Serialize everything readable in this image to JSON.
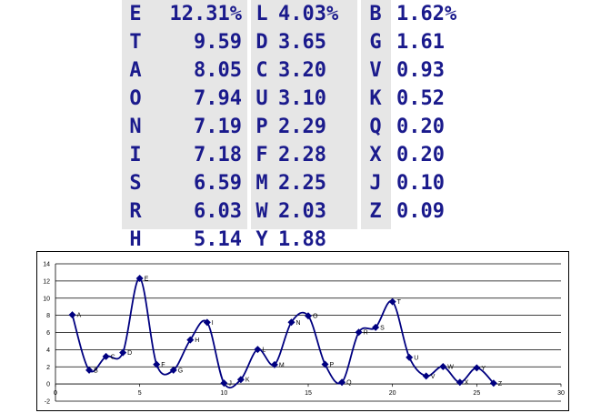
{
  "table": {
    "columns": [
      {
        "rows": [
          {
            "letter": "E",
            "value": "12.31%"
          },
          {
            "letter": "T",
            "value": "9.59"
          },
          {
            "letter": "A",
            "value": "8.05"
          },
          {
            "letter": "O",
            "value": "7.94"
          },
          {
            "letter": "N",
            "value": "7.19"
          },
          {
            "letter": "I",
            "value": "7.18"
          },
          {
            "letter": "S",
            "value": "6.59"
          },
          {
            "letter": "R",
            "value": "6.03"
          },
          {
            "letter": "H",
            "value": "5.14"
          }
        ]
      },
      {
        "rows": [
          {
            "letter": "L",
            "value": "4.03%"
          },
          {
            "letter": "D",
            "value": "3.65"
          },
          {
            "letter": "C",
            "value": "3.20"
          },
          {
            "letter": "U",
            "value": "3.10"
          },
          {
            "letter": "P",
            "value": "2.29"
          },
          {
            "letter": "F",
            "value": "2.28"
          },
          {
            "letter": "M",
            "value": "2.25"
          },
          {
            "letter": "W",
            "value": "2.03"
          },
          {
            "letter": "Y",
            "value": "1.88"
          }
        ]
      },
      {
        "rows": [
          {
            "letter": "B",
            "value": "1.62%"
          },
          {
            "letter": "G",
            "value": "1.61"
          },
          {
            "letter": "V",
            "value": "0.93"
          },
          {
            "letter": "K",
            "value": "0.52"
          },
          {
            "letter": "Q",
            "value": "0.20"
          },
          {
            "letter": "X",
            "value": "0.20"
          },
          {
            "letter": "J",
            "value": "0.10"
          },
          {
            "letter": "Z",
            "value": "0.09"
          }
        ]
      }
    ]
  },
  "chart_data": {
    "type": "line",
    "smoothed": true,
    "marker": "diamond",
    "color": "#000080",
    "grid": "horizontal",
    "legend": "none",
    "xlim": [
      0,
      30
    ],
    "ylim": [
      -2,
      14
    ],
    "xticks": [
      "0",
      "5",
      "10",
      "15",
      "20",
      "25",
      "30"
    ],
    "yticks": [
      "-2",
      "0",
      "2",
      "4",
      "6",
      "8",
      "10",
      "12",
      "14"
    ],
    "series": [
      {
        "points": [
          {
            "x": 1,
            "y": 8.05,
            "label": "A"
          },
          {
            "x": 2,
            "y": 1.62,
            "label": "B"
          },
          {
            "x": 3,
            "y": 3.2,
            "label": "C"
          },
          {
            "x": 4,
            "y": 3.65,
            "label": "D"
          },
          {
            "x": 5,
            "y": 12.31,
            "label": "E"
          },
          {
            "x": 6,
            "y": 2.28,
            "label": "F"
          },
          {
            "x": 7,
            "y": 1.61,
            "label": "G"
          },
          {
            "x": 8,
            "y": 5.14,
            "label": "H"
          },
          {
            "x": 9,
            "y": 7.18,
            "label": "I"
          },
          {
            "x": 10,
            "y": 0.1,
            "label": "J"
          },
          {
            "x": 11,
            "y": 0.52,
            "label": "K"
          },
          {
            "x": 12,
            "y": 4.03,
            "label": "L"
          },
          {
            "x": 13,
            "y": 2.25,
            "label": "M"
          },
          {
            "x": 14,
            "y": 7.19,
            "label": "N"
          },
          {
            "x": 15,
            "y": 7.94,
            "label": "O"
          },
          {
            "x": 16,
            "y": 2.29,
            "label": "P"
          },
          {
            "x": 17,
            "y": 0.2,
            "label": "Q"
          },
          {
            "x": 18,
            "y": 6.03,
            "label": "R"
          },
          {
            "x": 19,
            "y": 6.59,
            "label": "S"
          },
          {
            "x": 20,
            "y": 9.59,
            "label": "T"
          },
          {
            "x": 21,
            "y": 3.1,
            "label": "U"
          },
          {
            "x": 22,
            "y": 0.93,
            "label": "V"
          },
          {
            "x": 23,
            "y": 2.03,
            "label": "W"
          },
          {
            "x": 24,
            "y": 0.2,
            "label": "X"
          },
          {
            "x": 25,
            "y": 1.88,
            "label": "Y"
          },
          {
            "x": 26,
            "y": 0.09,
            "label": "Z"
          }
        ]
      }
    ]
  }
}
